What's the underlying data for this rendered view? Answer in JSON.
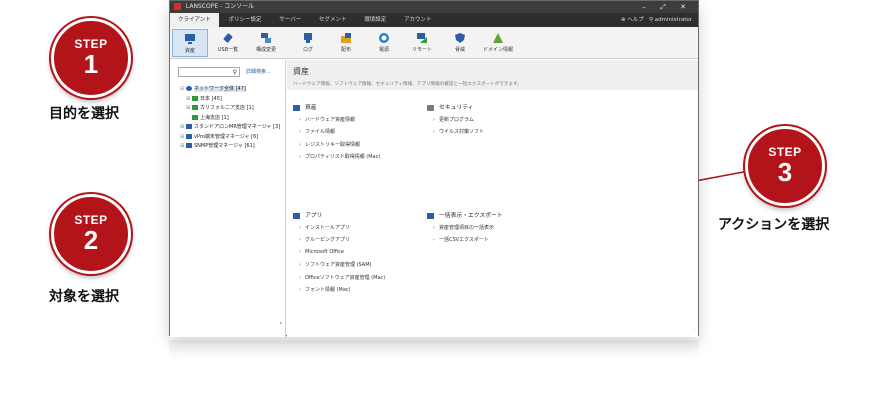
{
  "steps": [
    {
      "word": "STEP",
      "number": "1",
      "caption": "目的を選択"
    },
    {
      "word": "STEP",
      "number": "2",
      "caption": "対象を選択"
    },
    {
      "word": "STEP",
      "number": "3",
      "caption": "アクションを選択"
    }
  ],
  "window": {
    "title": "LANSCOPE - コンソール",
    "controls": [
      "–",
      "⤢",
      "✕"
    ],
    "menu_tabs": [
      "クライアント",
      "ポリシー設定",
      "サーバー",
      "セグメント",
      "環境設定",
      "アカウント"
    ],
    "help": "ヘルプ",
    "user": "administrator"
  },
  "toolbar": [
    {
      "label": "資産",
      "icon": "monitor-icon",
      "color": "#2a5fa8"
    },
    {
      "label": "USB一覧",
      "icon": "usb-icon",
      "color": "#2a5fa8"
    },
    {
      "label": "構成変更",
      "icon": "config-change-icon",
      "color": "#2a5fa8"
    },
    {
      "label": "ログ",
      "icon": "log-icon",
      "color": "#2a5fa8"
    },
    {
      "label": "配布",
      "icon": "distribute-icon",
      "color": "#e0a020"
    },
    {
      "label": "電源",
      "icon": "power-icon",
      "color": "#2a7fd4"
    },
    {
      "label": "リモート",
      "icon": "remote-icon",
      "color": "#2e9a3a"
    },
    {
      "label": "脅威",
      "icon": "shield-icon",
      "color": "#2a5fa8"
    },
    {
      "label": "ドメイン情報",
      "icon": "domain-icon",
      "color": "#5aa832"
    }
  ],
  "left_pane": {
    "search_placeholder": "",
    "advanced_search": "詳細検索...",
    "tree": [
      {
        "label": "ネットワーク全体 [47]",
        "toggle": "⊟",
        "selected": true
      },
      {
        "label": "日本 [45]",
        "toggle": "⊞",
        "selected": false
      },
      {
        "label": "カリフォルニア支店 [1]",
        "toggle": "⊞",
        "selected": false
      },
      {
        "label": "上海支店 [1]",
        "toggle": "",
        "selected": false
      },
      {
        "label": "スタンドアロンMR管理マネージャ [3]",
        "toggle": "⊞",
        "selected": false
      },
      {
        "label": "vPro端末管理マネージャ [6]",
        "toggle": "⊞",
        "selected": false
      },
      {
        "label": "SNMP管理マネージャ [61]",
        "toggle": "⊞",
        "selected": false
      }
    ]
  },
  "content": {
    "title": "資産",
    "subtitle": "ハードウェア情報、ソフトウェア情報、セキュリティ情報、アプリ情報の確認と一括エクスポートができます。",
    "sections": [
      {
        "title": "資産",
        "icon": "monitor-icon",
        "items": [
          "ハードウェア資産情報",
          "ファイル情報",
          "レジストリキー取得情報",
          "プロパティリスト取得情報 (Mac)"
        ]
      },
      {
        "title": "セキュリティ",
        "icon": "lock-icon",
        "items": [
          "更新プログラム",
          "ウイルス対策ソフト"
        ]
      },
      {
        "title": "アプリ",
        "icon": "app-icon",
        "items": [
          "インストールアプリ",
          "グルーピングアプリ",
          "Microsoft Office",
          "ソフトウェア資産管理 (SAM)",
          "Officeソフトウェア資産管理 (Mac)",
          "フォント情報 (Mac)"
        ]
      },
      {
        "title": "一括表示・エクスポート",
        "icon": "export-icon",
        "items": [
          "資産管理項目の一括表示",
          "一括CSVエクスポート"
        ]
      }
    ]
  },
  "colors": {
    "step_red": "#b3141a"
  }
}
